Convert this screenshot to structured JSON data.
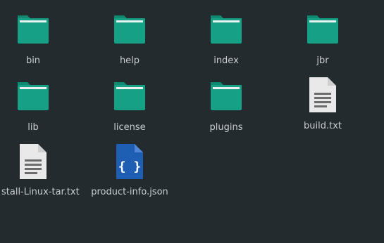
{
  "files": [
    {
      "name": "bin",
      "type": "folder"
    },
    {
      "name": "help",
      "type": "folder"
    },
    {
      "name": "index",
      "type": "folder"
    },
    {
      "name": "jbr",
      "type": "folder"
    },
    {
      "name": "lib",
      "type": "folder"
    },
    {
      "name": "license",
      "type": "folder"
    },
    {
      "name": "plugins",
      "type": "folder"
    },
    {
      "name": "build.txt",
      "type": "text-file"
    },
    {
      "name": "stall-Linux-tar.txt",
      "type": "text-file"
    },
    {
      "name": "product-info.json",
      "type": "json-file"
    }
  ],
  "colors": {
    "background": "#232b2e",
    "folder_body": "#16a085",
    "folder_tab": "#0f8a71",
    "folder_paper": "#e8f3ef",
    "text_file": "#e9e9e9",
    "json_file": "#1f5fb3",
    "label": "#c9cdcf"
  },
  "icons": {
    "folder": "folder-icon",
    "text-file": "text-file-icon",
    "json-file": "json-file-icon"
  }
}
